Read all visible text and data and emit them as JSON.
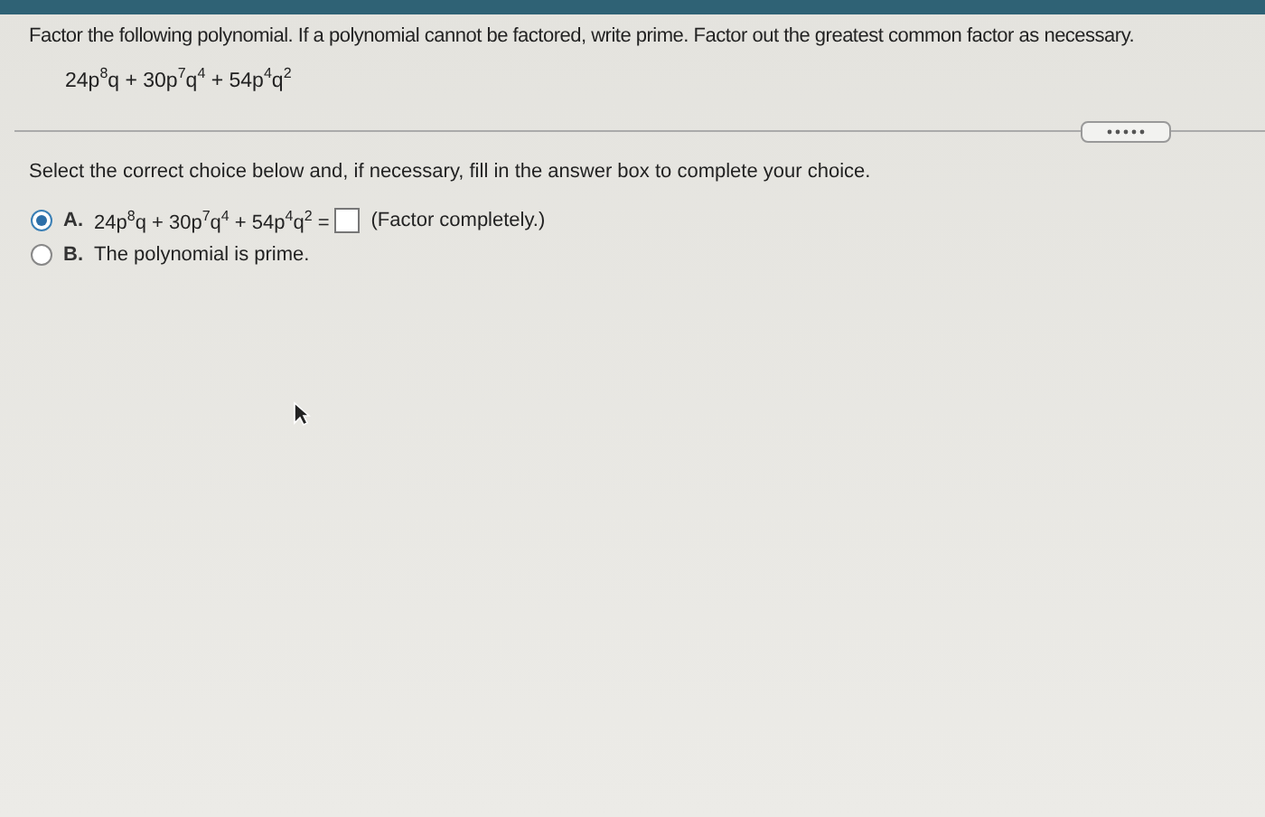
{
  "question": {
    "instruction": "Factor the following polynomial. If a polynomial cannot be factored, write prime. Factor out the greatest common factor as necessary.",
    "expression": "24p$^{8}$q + 30p$^{7}$q$^{4}$ + 54p$^{4}$q$^{2}$"
  },
  "prompt": "Select the correct choice below and, if necessary, fill in the answer box to complete your choice.",
  "choices": [
    {
      "kind": "answer",
      "letter": "A.",
      "expression": "24p$^{8}$q + 30p$^{7}$q$^{4}$ + 54p$^{4}$q$^{2}$ =",
      "hint": "(Factor completely.)",
      "selected": true
    },
    {
      "kind": "text",
      "letter": "B.",
      "text": "The polynomial is prime.",
      "selected": false
    }
  ]
}
